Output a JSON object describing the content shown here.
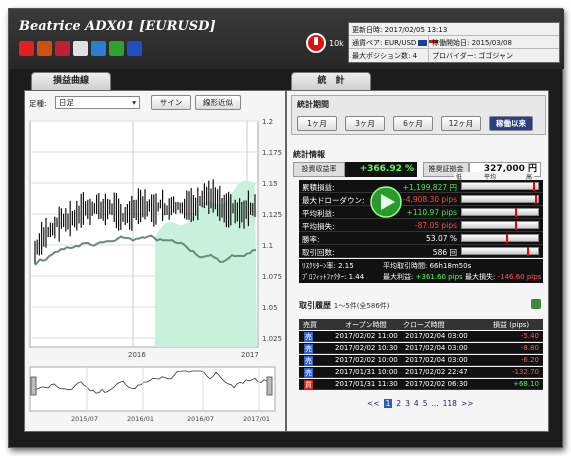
{
  "app": {
    "title": "Beatrice ADX01 [EURUSD]",
    "ten_k": "10k",
    "icons": [
      {
        "name": "smile-icon",
        "color": "#e02020"
      },
      {
        "name": "top100-icon",
        "color": "#d05010"
      },
      {
        "name": "top100-alt-icon",
        "color": "#c02030"
      },
      {
        "name": "gift-icon",
        "color": "#e0e0e0"
      },
      {
        "name": "chart-icon",
        "color": "#2a80d0"
      },
      {
        "name": "formula-icon",
        "color": "#30a030"
      },
      {
        "name": "globe-icon",
        "color": "#2050c0"
      }
    ]
  },
  "info": {
    "rows": [
      {
        "a": "更新日時: 2017/02/05 13:13",
        "b": ""
      },
      {
        "a": "通貨ペア: EUR/USD",
        "b": "稼働開始日: 2015/03/08"
      },
      {
        "a": "最大ポジション数: 4",
        "b": "プロバイダー: ゴゴジャン"
      }
    ]
  },
  "left_panel": {
    "tab": "損益曲線",
    "label": "足種:",
    "select_value": "日足",
    "btn1": "サイン",
    "btn2": "線形近似",
    "y_ticks": [
      "1.2",
      "1.175",
      "1.15",
      "1.125",
      "1.1",
      "1.075",
      "1.05",
      "1.025"
    ],
    "x_ticks": [
      "2016",
      "2017"
    ],
    "mini_x_ticks": [
      "2015/07",
      "2016/01",
      "2016/07",
      "2017/01"
    ]
  },
  "right_panel": {
    "tab": "統　計",
    "period_title": "統計期間",
    "periods": [
      "1ヶ月",
      "3ヶ月",
      "6ヶ月",
      "12ヶ月",
      "稼働以来"
    ],
    "info_title": "統計情報",
    "profit_rate_label": "投資収益率",
    "profit_rate_value": "+366.92 %",
    "capital_label": "推奨証拠金",
    "capital_value": "327,000 円",
    "scale_low": "低",
    "scale_mid": "平均",
    "scale_high": "高",
    "stats": [
      {
        "label": "累積損益:",
        "value": "+1,199,827 円",
        "color": "#44ee44",
        "level": 0.96
      },
      {
        "label": "最大ドローダウン:",
        "value": "-4,908.30 pips",
        "color": "#ff4444",
        "level": 0.98
      },
      {
        "label": "平均利益:",
        "value": "+110.97 pips",
        "color": "#44ee44",
        "level": 0.72
      },
      {
        "label": "平均損失:",
        "value": "-87.05 pips",
        "color": "#ff4444",
        "level": 0.72
      },
      {
        "label": "勝率:",
        "value": "53.07 %",
        "color": "#ffffff",
        "level": 0.6
      },
      {
        "label": "取引回数:",
        "value": "586 回",
        "color": "#ffffff",
        "level": 0.88
      }
    ],
    "extra1_a_label": "ﾘｽｸﾘﾀｰﾝ率:",
    "extra1_a": "2.15",
    "extra1_b_label": "平均取引時間:",
    "extra1_b": "66h18m50s",
    "extra2_a_label": "ﾌﾟﾛﾌｨｯﾄﾌｧｸﾀｰ:",
    "extra2_a": "1.44",
    "extra2_b_label": "最大利益:",
    "extra2_b": "+361.60 pips",
    "extra2_c_label": "最大損失:",
    "extra2_c": "-146.60 pips",
    "history_title": "取引履歴",
    "history_range": "1～5件(全586件)",
    "history_headers": [
      "売買",
      "オープン時間",
      "クローズ時間",
      "損益 (pips)"
    ],
    "history": [
      {
        "side": "売",
        "open": "2017/02/02 11:00",
        "close": "2017/02/04 03:00",
        "pnl": "-5.40",
        "color": "#ff5555",
        "side_color": "#3060d0"
      },
      {
        "side": "売",
        "open": "2017/02/02 10:30",
        "close": "2017/02/04 03:00",
        "pnl": "-8.80",
        "color": "#ff5555",
        "side_color": "#3060d0"
      },
      {
        "side": "売",
        "open": "2017/02/02 10:00",
        "close": "2017/02/04 03:00",
        "pnl": "-6.20",
        "color": "#ff5555",
        "side_color": "#3060d0"
      },
      {
        "side": "売",
        "open": "2017/01/31 10:00",
        "close": "2017/02/02 22:47",
        "pnl": "-132.70",
        "color": "#ff5555",
        "side_color": "#3060d0"
      },
      {
        "side": "買",
        "open": "2017/01/31 11:30",
        "close": "2017/02/02 06:30",
        "pnl": "+68.10",
        "color": "#55ee55",
        "side_color": "#d02020"
      }
    ],
    "pager": [
      "<<",
      "1",
      "2",
      "3",
      "4",
      "5",
      "...",
      "118",
      ">>"
    ]
  }
}
